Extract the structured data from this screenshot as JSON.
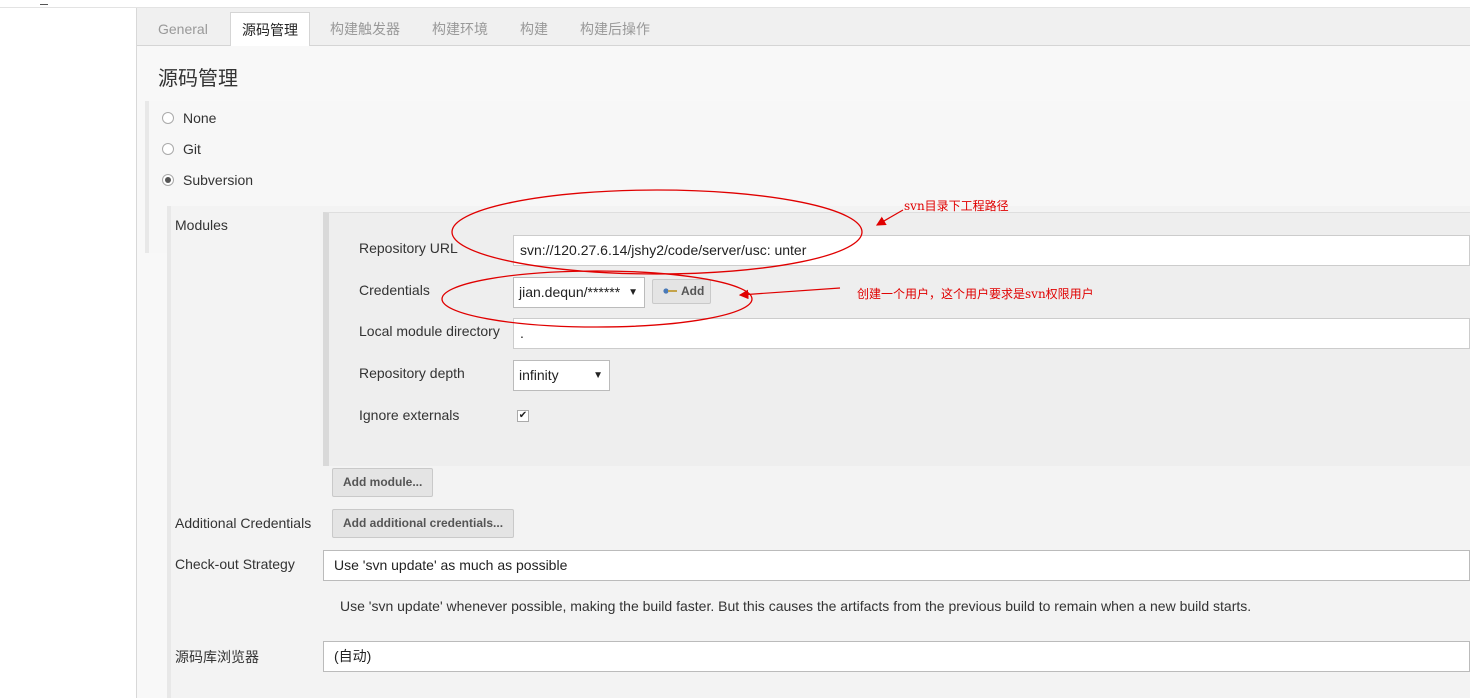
{
  "tabs": [
    "General",
    "源码管理",
    "构建触发器",
    "构建环境",
    "构建",
    "构建后操作"
  ],
  "section_title": "源码管理",
  "scm_options": [
    "None",
    "Git",
    "Subversion"
  ],
  "modules": {
    "label": "Modules",
    "repository_url_label": "Repository URL",
    "repository_url_value": "svn://120.27.6.14/jshy2/code/server/usc:   unter",
    "credentials_label": "Credentials",
    "credentials_value": "jian.dequn/******",
    "credentials_add": "Add",
    "local_dir_label": "Local module directory",
    "local_dir_value": ".",
    "depth_label": "Repository depth",
    "depth_value": "infinity",
    "ignore_label": "Ignore externals",
    "ignore_checked": "✔",
    "add_module": "Add module..."
  },
  "additional_credentials": {
    "label": "Additional Credentials",
    "button": "Add additional credentials..."
  },
  "checkout": {
    "label": "Check-out Strategy",
    "value": "Use 'svn update' as much as possible",
    "description": "Use 'svn update' whenever possible, making the build faster. But this causes the artifacts from the previous build to remain when a new build starts."
  },
  "browser": {
    "label": "源码库浏览器",
    "value": "(自动)"
  },
  "annotations": {
    "svn_path": "svn目录下工程路径",
    "user_note": "创建一个用户，这个用户要求是svn权限用户"
  },
  "colors": {
    "annotation_red": "#e00000"
  }
}
